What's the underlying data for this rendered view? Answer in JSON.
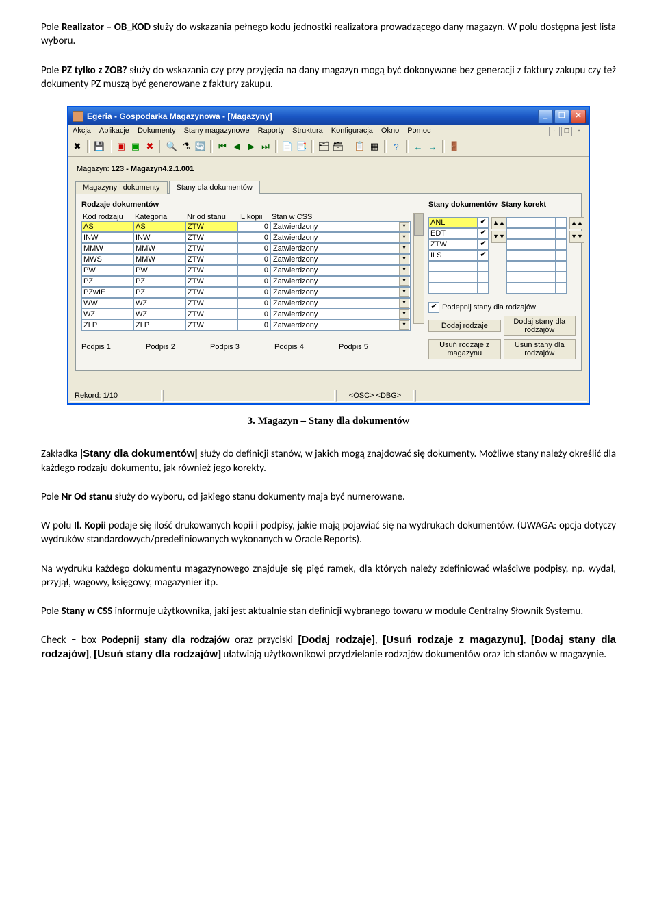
{
  "para1_a": "Pole ",
  "para1_b": "Realizator – OB_KOD",
  "para1_c": " służy do wskazania pełnego kodu jednostki realizatora prowadzącego dany magazyn. W polu dostępna jest lista wyboru.",
  "para2_a": "Pole ",
  "para2_b": "PZ tylko z ZOB?",
  "para2_c": " służy do wskazania czy przy przyjęcia na dany magazyn mogą być dokonywane bez generacji z faktury zakupu czy też dokumenty PZ muszą być generowane z faktury zakupu.",
  "caption": "3.    Magazyn – Stany dla dokumentów",
  "para3_a": "Zakładka ",
  "para3_b": "|Stany dla dokumentów|",
  "para3_c": " służy do definicji stanów, w jakich mogą znajdować się dokumenty. Możliwe stany należy określić dla każdego rodzaju dokumentu, jak również jego korekty.",
  "para4_a": "Pole ",
  "para4_b": "Nr Od stanu",
  "para4_c": " służy do wyboru, od jakiego stanu dokumenty maja być numerowane.",
  "para5_a": "W polu ",
  "para5_b": "Il. Kopii",
  "para5_c": " podaje się ilość drukowanych kopii i podpisy, jakie mają pojawiać się na wydrukach dokumentów. (UWAGA: opcja dotyczy wydruków standardowych/predefiniowanych wykonanych w Oracle Reports).",
  "para6": "Na wydruku każdego dokumentu magazynowego znajduje się pięć ramek, dla których należy zdefiniować właściwe podpisy, np. wydał, przyjął, wagowy, księgowy, magazynier itp.",
  "para7_a": "Pole ",
  "para7_b": "Stany w CSS",
  "para7_c": " informuje użytkownika, jaki jest aktualnie stan definicji wybranego towaru w module Centralny Słownik Systemu.",
  "para8_a": "Check – box ",
  "para8_b": "Podepnij stany dla rodzajów",
  "para8_c": " oraz przyciski ",
  "para8_d": "[Dodaj rodzaje]",
  "para8_e": ", ",
  "para8_f": "[Usuń rodzaje z magazynu]",
  "para8_g": ", ",
  "para8_h": "[Dodaj stany dla rodzajów]",
  "para8_i": ", ",
  "para8_j": "[Usuń stany dla rodzajów]",
  "para8_k": " ułatwiają użytkownikowi przydzielanie rodzajów dokumentów oraz ich stanów w magazynie.",
  "app": {
    "title": "Egeria - Gospodarka Magazynowa - [Magazyny]",
    "menus": [
      "Akcja",
      "Aplikacje",
      "Dokumenty",
      "Stany magazynowe",
      "Raporty",
      "Struktura",
      "Konfiguracja",
      "Okno",
      "Pomoc"
    ],
    "magazyn_label": "Magazyn:",
    "magazyn_value": "123 - Magazyn4.2.1.001",
    "tabs": {
      "tab1": "Magazyny i dokumenty",
      "tab2": "Stany dla dokumentów"
    },
    "group_left": "Rodzaje dokumentów",
    "group_mid": "Stany dokumentów",
    "group_right": "Stany korekt",
    "headers_left": [
      "Kod rodzaju",
      "Kategoria",
      "Nr od stanu",
      "IL kopii",
      "Stan w CSS"
    ],
    "rows": [
      {
        "kod": "AS",
        "kat": "AS",
        "nr": "ZTW",
        "il": "0",
        "stan": "Zatwierdzony",
        "sel": true
      },
      {
        "kod": "INW",
        "kat": "INW",
        "nr": "ZTW",
        "il": "0",
        "stan": "Zatwierdzony"
      },
      {
        "kod": "MMW",
        "kat": "MMW",
        "nr": "ZTW",
        "il": "0",
        "stan": "Zatwierdzony"
      },
      {
        "kod": "MWS",
        "kat": "MMW",
        "nr": "ZTW",
        "il": "0",
        "stan": "Zatwierdzony"
      },
      {
        "kod": "PW",
        "kat": "PW",
        "nr": "ZTW",
        "il": "0",
        "stan": "Zatwierdzony"
      },
      {
        "kod": "PZ",
        "kat": "PZ",
        "nr": "ZTW",
        "il": "0",
        "stan": "Zatwierdzony"
      },
      {
        "kod": "PZwIE",
        "kat": "PZ",
        "nr": "ZTW",
        "il": "0",
        "stan": "Zatwierdzony"
      },
      {
        "kod": "WW",
        "kat": "WZ",
        "nr": "ZTW",
        "il": "0",
        "stan": "Zatwierdzony"
      },
      {
        "kod": "WZ",
        "kat": "WZ",
        "nr": "ZTW",
        "il": "0",
        "stan": "Zatwierdzony"
      },
      {
        "kod": "ZLP",
        "kat": "ZLP",
        "nr": "ZTW",
        "il": "0",
        "stan": "Zatwierdzony"
      }
    ],
    "stany_dok": [
      {
        "code": "ANL",
        "checked": true,
        "sel": true
      },
      {
        "code": "EDT",
        "checked": true
      },
      {
        "code": "ZTW",
        "checked": true
      },
      {
        "code": "ILS",
        "checked": true
      },
      {
        "code": "",
        "checked": false
      },
      {
        "code": "",
        "checked": false
      },
      {
        "code": "",
        "checked": false
      }
    ],
    "stany_kor": [
      {
        "code": "",
        "checked": false
      },
      {
        "code": "",
        "checked": false
      },
      {
        "code": "",
        "checked": false
      },
      {
        "code": "",
        "checked": false
      },
      {
        "code": "",
        "checked": false
      },
      {
        "code": "",
        "checked": false
      },
      {
        "code": "",
        "checked": false
      }
    ],
    "podepnij_label": "Podepnij stany dla rodzajów",
    "btn_dodaj_rodzaje": "Dodaj rodzaje",
    "btn_dodaj_stany": "Dodaj stany dla rodzajów",
    "btn_usun_rodzaje": "Usuń rodzaje z magazynu",
    "btn_usun_stany": "Usuń stany dla rodzajów",
    "podpis_labels": [
      "Podpis 1",
      "Podpis 2",
      "Podpis 3",
      "Podpis 4",
      "Podpis 5"
    ],
    "status_left": "Rekord: 1/10",
    "status_mid": "<OSC> <DBG>"
  }
}
